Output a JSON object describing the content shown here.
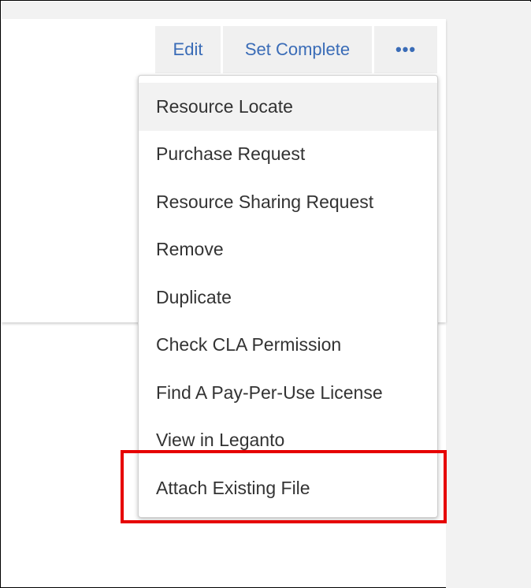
{
  "toolbar": {
    "edit_label": "Edit",
    "set_complete_label": "Set Complete",
    "more_label": "•••"
  },
  "menu": {
    "items": [
      {
        "label": "Resource Locate",
        "active": true
      },
      {
        "label": "Purchase Request"
      },
      {
        "label": "Resource Sharing Request"
      },
      {
        "label": "Remove"
      },
      {
        "label": "Duplicate"
      },
      {
        "label": "Check CLA Permission"
      },
      {
        "label": "Find A Pay-Per-Use License"
      },
      {
        "label": "View in Leganto"
      },
      {
        "label": "Attach Existing File"
      }
    ]
  },
  "colors": {
    "link_blue": "#3a6cb7",
    "highlight_red": "#e60000",
    "menu_text": "#333333",
    "panel_grey": "#f2f2f2"
  },
  "icons": {
    "more": "ellipsis-icon"
  }
}
